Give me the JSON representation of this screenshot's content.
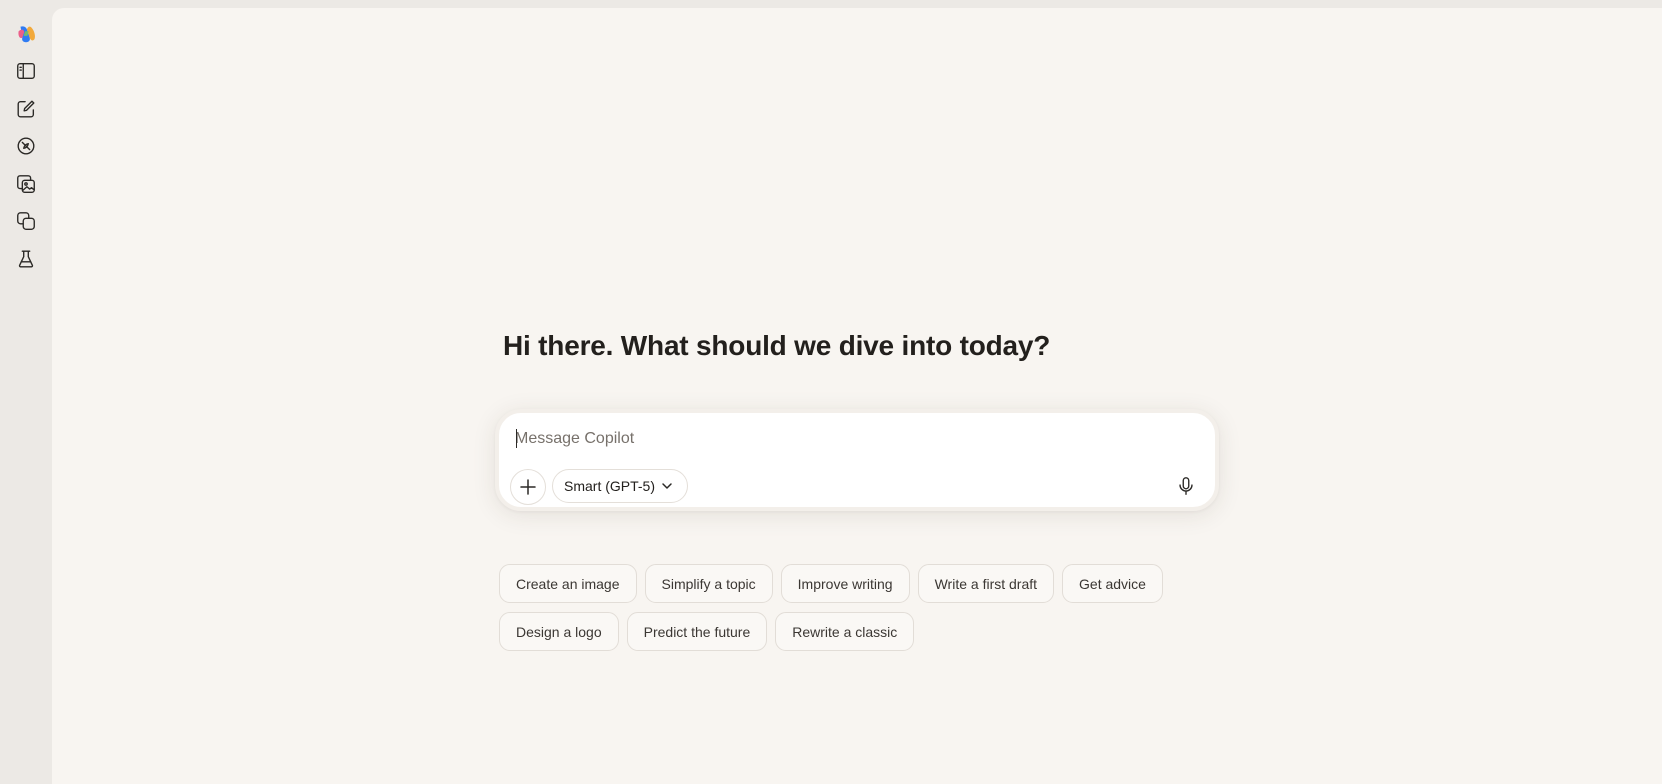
{
  "sidebar": {
    "items": [
      {
        "icon": "copilot-logo-icon"
      },
      {
        "icon": "sidebar-toggle-icon"
      },
      {
        "icon": "new-chat-icon"
      },
      {
        "icon": "discover-icon"
      },
      {
        "icon": "image-gallery-icon"
      },
      {
        "icon": "pages-icon"
      },
      {
        "icon": "labs-icon"
      }
    ]
  },
  "main": {
    "greeting": "Hi there. What should we dive into today?"
  },
  "composer": {
    "placeholder": "Message Copilot",
    "value": "",
    "model_label": "Smart (GPT-5)"
  },
  "suggestions": {
    "row1": [
      "Create an image",
      "Simplify a topic",
      "Improve writing",
      "Write a first draft",
      "Get advice"
    ],
    "row2": [
      "Design a logo",
      "Predict the future",
      "Rewrite a classic"
    ]
  }
}
